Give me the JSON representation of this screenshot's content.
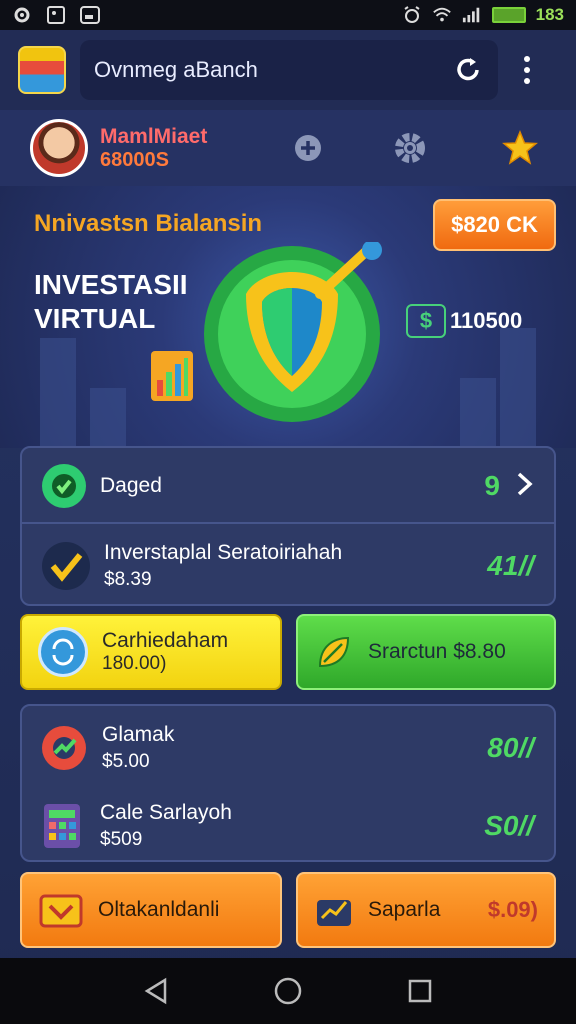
{
  "status_bar": {
    "time": "183"
  },
  "header": {
    "search_label": "Ovnmeg aBanch"
  },
  "profile": {
    "name": "MamlMiaet",
    "balance": "68000S"
  },
  "hero": {
    "title": "Nnivastsn Bialansin",
    "headline_line1": "INVESTASII",
    "headline_line2": "VIRTUAL",
    "cta_label": "$820 CK",
    "amount": "110500"
  },
  "summary_card": {
    "row1": {
      "label": "Daged",
      "value": "9"
    },
    "row2": {
      "label": "Inverstaplal Seratoiriahah",
      "sub": "$8.39",
      "value": "41//"
    }
  },
  "action_buttons": {
    "left": {
      "label": "Carhiedaham",
      "sub": "180.00)"
    },
    "right": {
      "label": "Srarctun $8.80"
    }
  },
  "list_card": {
    "item1": {
      "label": "Glamak",
      "sub": "$5.00",
      "value": "80//"
    },
    "item2": {
      "label": "Cale Sarlayoh",
      "sub": "$509",
      "value": "S0//"
    }
  },
  "bottom_buttons": {
    "left": {
      "label": "Oltakanldanli"
    },
    "right": {
      "label": "Saparla",
      "value": "$.09)"
    }
  },
  "colors": {
    "accent_orange": "#f06a10",
    "accent_green": "#4fd964",
    "accent_yellow": "#f7e623"
  }
}
